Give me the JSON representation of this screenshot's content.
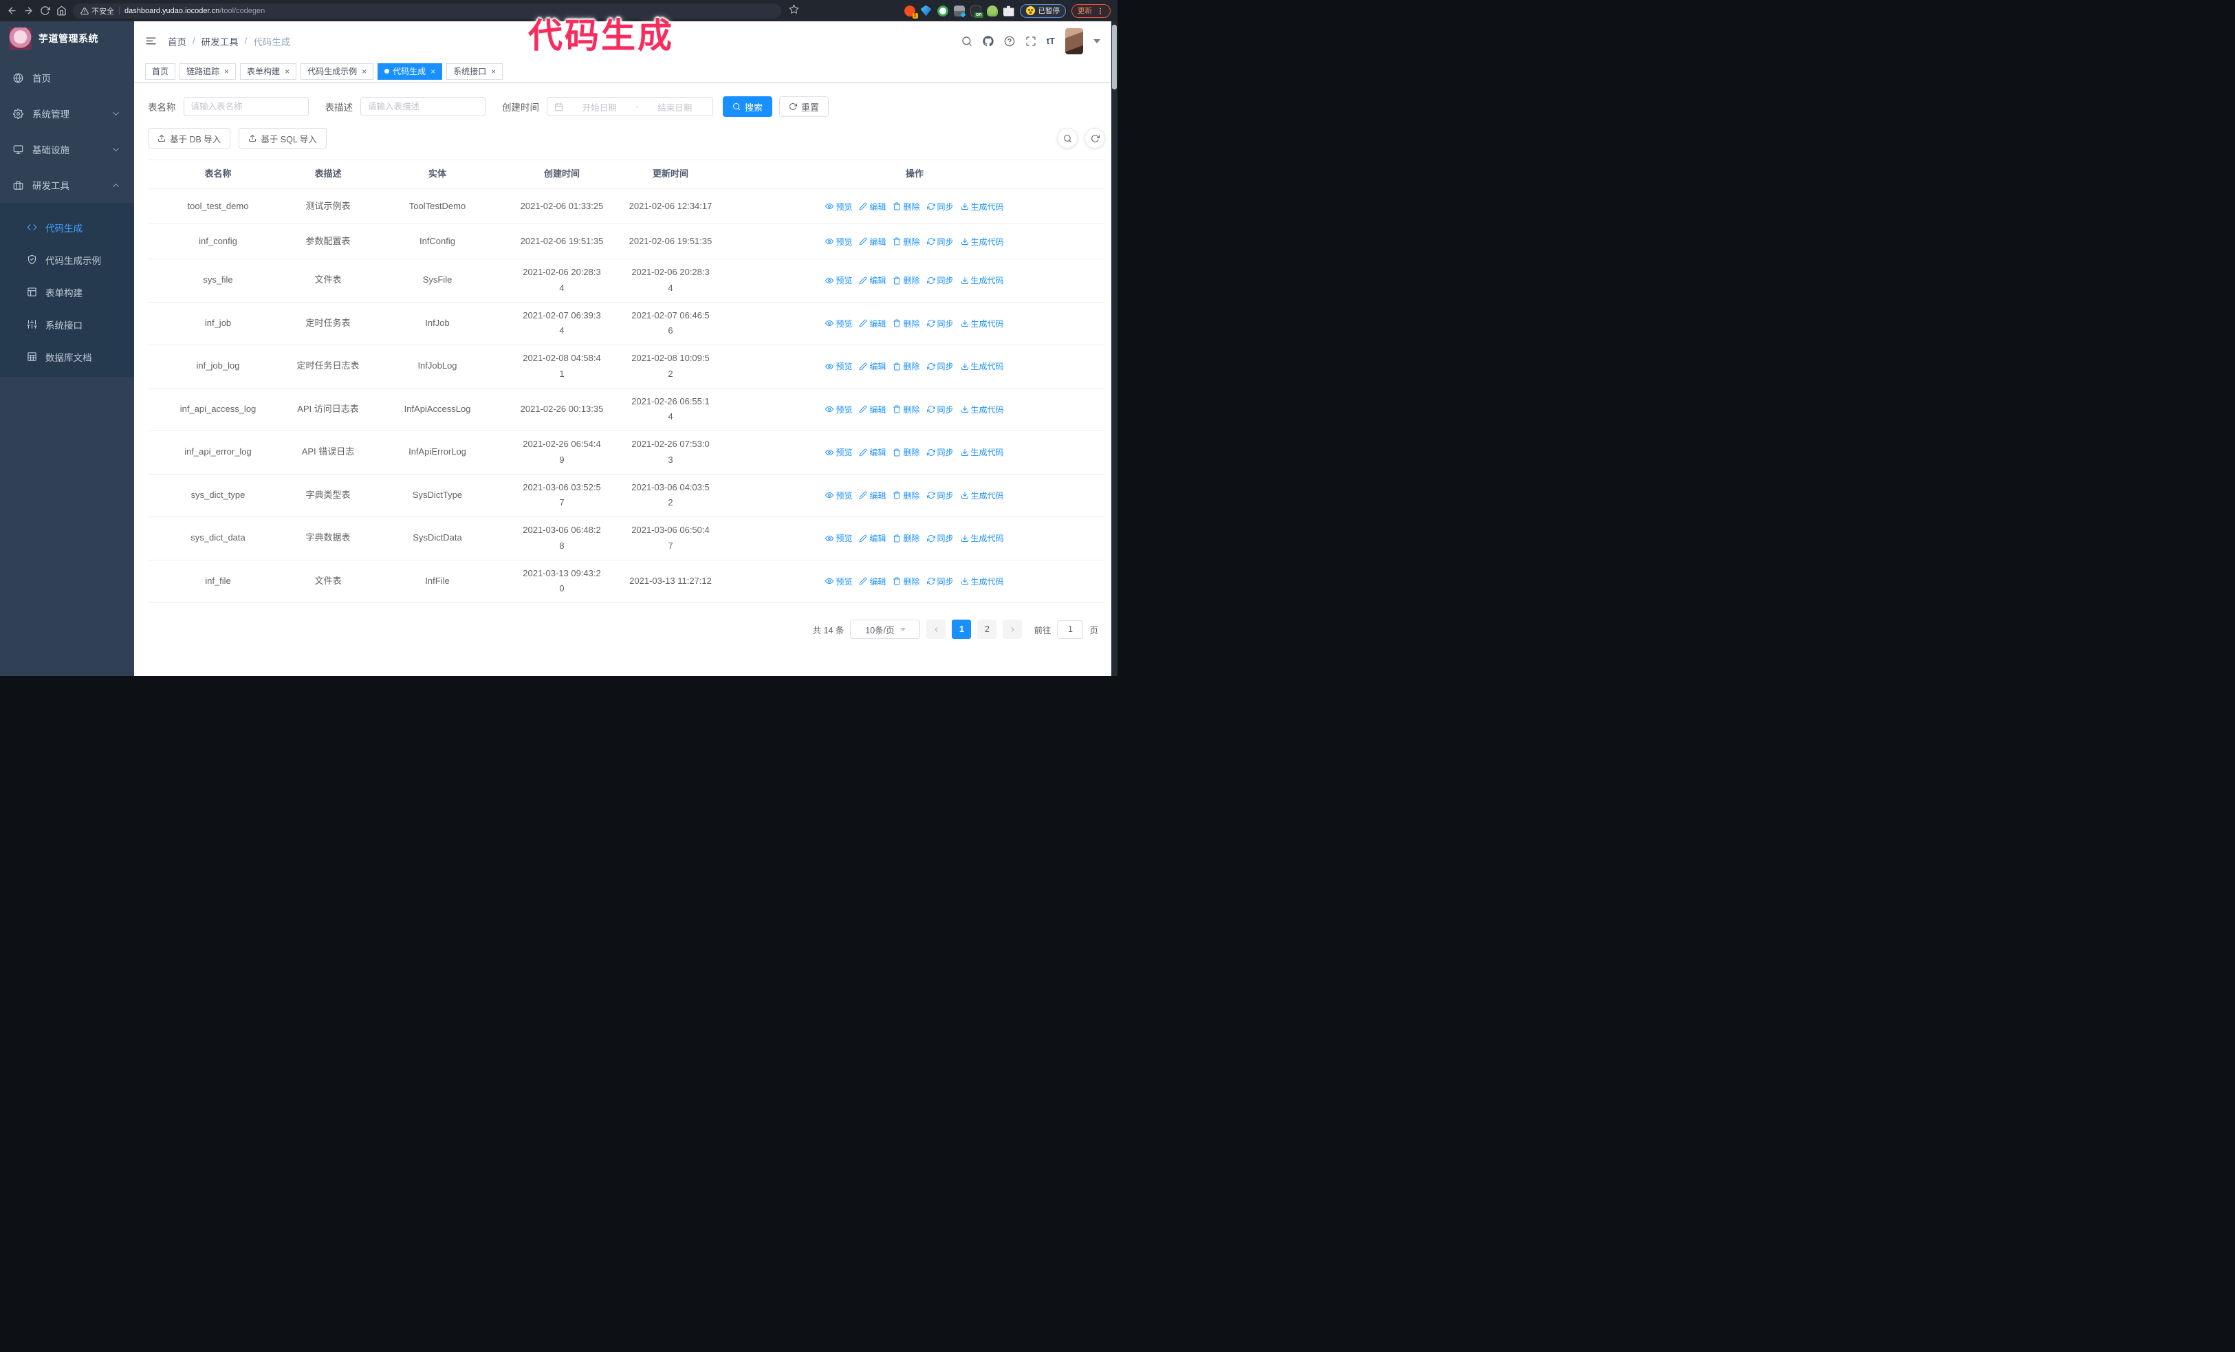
{
  "overlay_title": "代码生成",
  "browser": {
    "security_label": "不安全",
    "url_host": "dashboard.yudao.iocoder.cn",
    "url_path": "/tool/codegen",
    "paused_badge": "已暂停",
    "update_button": "更新"
  },
  "sidebar": {
    "logo_title": "芋道管理系统",
    "items": [
      {
        "label": "首页",
        "icon": "globe",
        "type": "leaf"
      },
      {
        "label": "系统管理",
        "icon": "gear",
        "type": "group",
        "expanded": false
      },
      {
        "label": "基础设施",
        "icon": "monitor",
        "type": "group",
        "expanded": false
      },
      {
        "label": "研发工具",
        "icon": "briefcase",
        "type": "group",
        "expanded": true,
        "children": [
          {
            "label": "代码生成",
            "icon": "code",
            "active": true
          },
          {
            "label": "代码生成示例",
            "icon": "shield-check",
            "active": false
          },
          {
            "label": "表单构建",
            "icon": "form",
            "active": false
          },
          {
            "label": "系统接口",
            "icon": "sliders",
            "active": false
          },
          {
            "label": "数据库文档",
            "icon": "db-table",
            "active": false
          }
        ]
      }
    ]
  },
  "header": {
    "breadcrumb": [
      "首页",
      "研发工具",
      "代码生成"
    ],
    "font_size_icon": "tT"
  },
  "tabs": [
    {
      "label": "首页",
      "closable": false,
      "active": false
    },
    {
      "label": "链路追踪",
      "closable": true,
      "active": false
    },
    {
      "label": "表单构建",
      "closable": true,
      "active": false
    },
    {
      "label": "代码生成示例",
      "closable": true,
      "active": false
    },
    {
      "label": "代码生成",
      "closable": true,
      "active": true
    },
    {
      "label": "系统接口",
      "closable": true,
      "active": false
    }
  ],
  "filters": {
    "table_name_label": "表名称",
    "table_name_placeholder": "请输入表名称",
    "table_desc_label": "表描述",
    "table_desc_placeholder": "请输入表描述",
    "create_time_label": "创建时间",
    "date_start_placeholder": "开始日期",
    "date_separator": "-",
    "date_end_placeholder": "结束日期",
    "search_button": "搜索",
    "reset_button": "重置"
  },
  "toolbar": {
    "import_db_button": "基于 DB 导入",
    "import_sql_button": "基于 SQL 导入"
  },
  "table": {
    "columns": [
      "表名称",
      "表描述",
      "实体",
      "创建时间",
      "更新时间",
      "操作"
    ],
    "actions": [
      "预览",
      "编辑",
      "删除",
      "同步",
      "生成代码"
    ],
    "rows": [
      {
        "name": "tool_test_demo",
        "desc": "测试示例表",
        "entity": "ToolTestDemo",
        "created": "2021-02-06 01:33:25",
        "updated": "2021-02-06 12:34:17"
      },
      {
        "name": "inf_config",
        "desc": "参数配置表",
        "entity": "InfConfig",
        "created": "2021-02-06 19:51:35",
        "updated": "2021-02-06 19:51:35"
      },
      {
        "name": "sys_file",
        "desc": "文件表",
        "entity": "SysFile",
        "created": "2021-02-06 20:28:3\n4",
        "updated": "2021-02-06 20:28:3\n4"
      },
      {
        "name": "inf_job",
        "desc": "定时任务表",
        "entity": "InfJob",
        "created": "2021-02-07 06:39:3\n4",
        "updated": "2021-02-07 06:46:5\n6"
      },
      {
        "name": "inf_job_log",
        "desc": "定时任务日志表",
        "entity": "InfJobLog",
        "created": "2021-02-08 04:58:4\n1",
        "updated": "2021-02-08 10:09:5\n2"
      },
      {
        "name": "inf_api_access_log",
        "desc": "API 访问日志表",
        "entity": "InfApiAccessLog",
        "created": "2021-02-26 00:13:35",
        "updated": "2021-02-26 06:55:1\n4"
      },
      {
        "name": "inf_api_error_log",
        "desc": "API 错误日志",
        "entity": "InfApiErrorLog",
        "created": "2021-02-26 06:54:4\n9",
        "updated": "2021-02-26 07:53:0\n3"
      },
      {
        "name": "sys_dict_type",
        "desc": "字典类型表",
        "entity": "SysDictType",
        "created": "2021-03-06 03:52:5\n7",
        "updated": "2021-03-06 04:03:5\n2"
      },
      {
        "name": "sys_dict_data",
        "desc": "字典数据表",
        "entity": "SysDictData",
        "created": "2021-03-06 06:48:2\n8",
        "updated": "2021-03-06 06:50:4\n7"
      },
      {
        "name": "inf_file",
        "desc": "文件表",
        "entity": "InfFile",
        "created": "2021-03-13 09:43:2\n0",
        "updated": "2021-03-13 11:27:12"
      }
    ]
  },
  "pagination": {
    "total_text": "共 14 条",
    "page_size": "10条/页",
    "pages": [
      "1",
      "2"
    ],
    "active_page": "1",
    "goto_label": "前往",
    "goto_value": "1",
    "page_suffix": "页"
  },
  "colors": {
    "accent": "#1890ff",
    "sidebar_bg": "#304156",
    "submenu_bg": "#263a4f",
    "annotation": "#fa2c5e",
    "browser_bar_bg": "#21262f"
  }
}
